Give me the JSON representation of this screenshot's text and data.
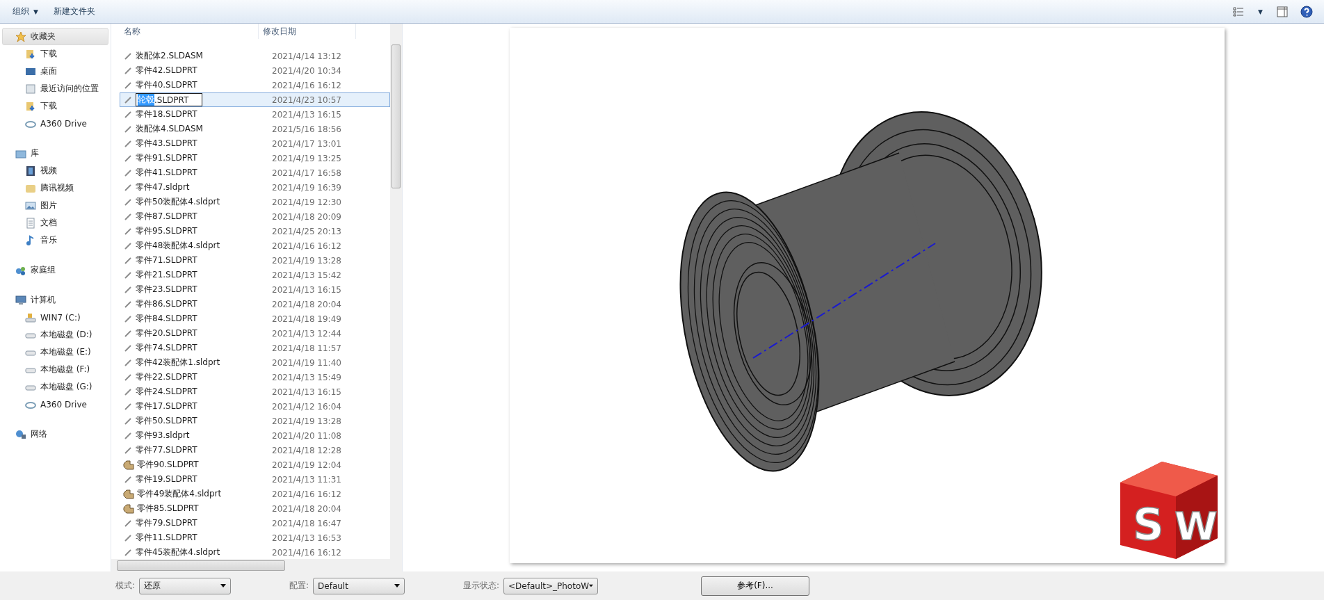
{
  "toolbar": {
    "organize": {
      "label": "组织",
      "caret": "▼"
    },
    "new_folder": "新建文件夹",
    "view_caret": "▼"
  },
  "sidebar": {
    "groups": [
      {
        "label": "收藏夹",
        "kind": "star",
        "selected": true,
        "children": [
          {
            "label": "下载",
            "kind": "download",
            "selected": false
          },
          {
            "label": "桌面",
            "kind": "desktop",
            "selected": false
          },
          {
            "label": "最近访问的位置",
            "kind": "recent",
            "selected": false
          },
          {
            "label": "下载",
            "kind": "download",
            "selected": false
          },
          {
            "label": "A360 Drive",
            "kind": "cloud",
            "selected": false
          }
        ]
      },
      {
        "label": "库",
        "kind": "library",
        "selected": false,
        "children": [
          {
            "label": "视频",
            "kind": "video",
            "selected": false
          },
          {
            "label": "腾讯视频",
            "kind": "folder",
            "selected": false
          },
          {
            "label": "图片",
            "kind": "picture",
            "selected": false
          },
          {
            "label": "文档",
            "kind": "document",
            "selected": false
          },
          {
            "label": "音乐",
            "kind": "music",
            "selected": false
          }
        ]
      },
      {
        "label": "家庭组",
        "kind": "homegroup",
        "selected": false
      },
      {
        "label": "计算机",
        "kind": "computer",
        "selected": false,
        "children": [
          {
            "label": "WIN7 (C:)",
            "kind": "system-drive",
            "selected": false
          },
          {
            "label": "本地磁盘 (D:)",
            "kind": "drive",
            "selected": false
          },
          {
            "label": "本地磁盘 (E:)",
            "kind": "drive",
            "selected": false
          },
          {
            "label": "本地磁盘 (F:)",
            "kind": "drive",
            "selected": false
          },
          {
            "label": "本地磁盘 (G:)",
            "kind": "drive",
            "selected": false
          },
          {
            "label": "A360 Drive",
            "kind": "cloud",
            "selected": false
          }
        ]
      },
      {
        "label": "网络",
        "kind": "network",
        "selected": false
      }
    ]
  },
  "table": {
    "columns": [
      "名称",
      "修改日期"
    ],
    "rows": [
      {
        "name": "装配体2.SLDASM",
        "date": "2021/4/14 13:12",
        "kind": "thumb",
        "selected": false
      },
      {
        "name": "零件42.SLDPRT",
        "date": "2021/4/20 10:34",
        "kind": "thumb",
        "selected": false
      },
      {
        "name": "零件40.SLDPRT",
        "date": "2021/4/16 16:12",
        "kind": "thumb",
        "selected": false
      },
      {
        "name_parts": [
          "轮毂",
          ".SLDPRT"
        ],
        "date": "2021/4/23 10:57",
        "kind": "thumb",
        "selected": true
      },
      {
        "name": "零件18.SLDPRT",
        "date": "2021/4/13 16:15",
        "kind": "thumb",
        "selected": false
      },
      {
        "name": "装配体4.SLDASM",
        "date": "2021/5/16 18:56",
        "kind": "thumb",
        "selected": false
      },
      {
        "name": "零件43.SLDPRT",
        "date": "2021/4/17 13:01",
        "kind": "thumb",
        "selected": false
      },
      {
        "name": "零件91.SLDPRT",
        "date": "2021/4/19 13:25",
        "kind": "thumb",
        "selected": false
      },
      {
        "name": "零件41.SLDPRT",
        "date": "2021/4/17 16:58",
        "kind": "thumb",
        "selected": false
      },
      {
        "name": "零件47.sldprt",
        "date": "2021/4/19 16:39",
        "kind": "thumb",
        "selected": false
      },
      {
        "name": "零件50装配体4.sldprt",
        "date": "2021/4/19 12:30",
        "kind": "thumb",
        "selected": false
      },
      {
        "name": "零件87.SLDPRT",
        "date": "2021/4/18 20:09",
        "kind": "thumb",
        "selected": false
      },
      {
        "name": "零件95.SLDPRT",
        "date": "2021/4/25 20:13",
        "kind": "thumb",
        "selected": false
      },
      {
        "name": "零件48装配体4.sldprt",
        "date": "2021/4/16 16:12",
        "kind": "thumb",
        "selected": false
      },
      {
        "name": "零件71.SLDPRT",
        "date": "2021/4/19 13:28",
        "kind": "thumb",
        "selected": false
      },
      {
        "name": "零件21.SLDPRT",
        "date": "2021/4/13 15:42",
        "kind": "thumb",
        "selected": false
      },
      {
        "name": "零件23.SLDPRT",
        "date": "2021/4/13 16:15",
        "kind": "thumb",
        "selected": false
      },
      {
        "name": "零件86.SLDPRT",
        "date": "2021/4/18 20:04",
        "kind": "thumb",
        "selected": false
      },
      {
        "name": "零件84.SLDPRT",
        "date": "2021/4/18 19:49",
        "kind": "thumb",
        "selected": false
      },
      {
        "name": "零件20.SLDPRT",
        "date": "2021/4/13 12:44",
        "kind": "thumb",
        "selected": false
      },
      {
        "name": "零件74.SLDPRT",
        "date": "2021/4/18 11:57",
        "kind": "thumb",
        "selected": false
      },
      {
        "name": "零件42装配体1.sldprt",
        "date": "2021/4/19 11:40",
        "kind": "thumb",
        "selected": false
      },
      {
        "name": "零件22.SLDPRT",
        "date": "2021/4/13 15:49",
        "kind": "thumb",
        "selected": false
      },
      {
        "name": "零件24.SLDPRT",
        "date": "2021/4/13 16:15",
        "kind": "thumb",
        "selected": false
      },
      {
        "name": "零件17.SLDPRT",
        "date": "2021/4/12 16:04",
        "kind": "thumb",
        "selected": false
      },
      {
        "name": "零件50.SLDPRT",
        "date": "2021/4/19 13:28",
        "kind": "thumb",
        "selected": false
      },
      {
        "name": "零件93.sldprt",
        "date": "2021/4/20 11:08",
        "kind": "thumb",
        "selected": false
      },
      {
        "name": "零件77.SLDPRT",
        "date": "2021/4/18 12:28",
        "kind": "thumb",
        "selected": false
      },
      {
        "name": "零件90.SLDPRT",
        "date": "2021/4/19 12:04",
        "kind": "part",
        "selected": false
      },
      {
        "name": "零件19.SLDPRT",
        "date": "2021/4/13 11:31",
        "kind": "thumb",
        "selected": false
      },
      {
        "name": "零件49装配体4.sldprt",
        "date": "2021/4/16 16:12",
        "kind": "part",
        "selected": false
      },
      {
        "name": "零件85.SLDPRT",
        "date": "2021/4/18 20:04",
        "kind": "part",
        "selected": false
      },
      {
        "name": "零件79.SLDPRT",
        "date": "2021/4/18 16:47",
        "kind": "thumb",
        "selected": false
      },
      {
        "name": "零件11.SLDPRT",
        "date": "2021/4/13 16:53",
        "kind": "thumb",
        "selected": false
      },
      {
        "name": "零件45装配体4.sldprt",
        "date": "2021/4/16 16:12",
        "kind": "thumb",
        "selected": false
      }
    ]
  },
  "preview": {
    "logo_letters": [
      "S",
      "W"
    ]
  },
  "bottom_bar": {
    "fields": [
      {
        "label": "模式:",
        "value": "还原"
      },
      {
        "label": "配置:",
        "value": "Default"
      },
      {
        "label": "显示状态:",
        "value": "<Default>_PhotoW"
      }
    ],
    "button": "参考(F)..."
  }
}
